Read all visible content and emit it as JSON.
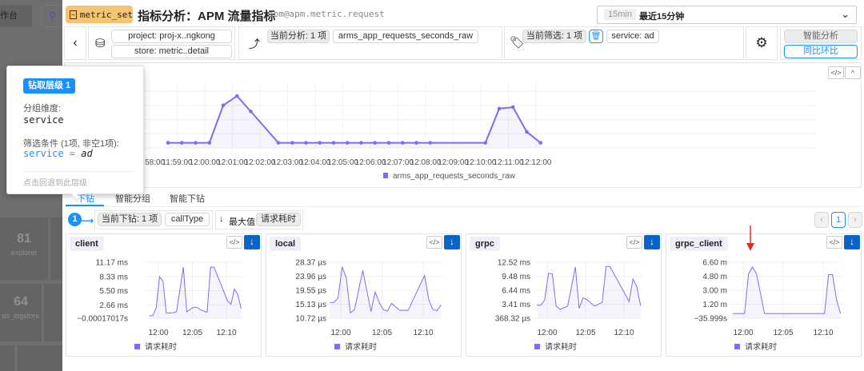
{
  "background": {
    "tab_label": "作台",
    "tiles": [
      {
        "count": "81",
        "name": "explorer"
      },
      {
        "count": "64",
        "name": "ds_logstore"
      }
    ]
  },
  "header": {
    "badge": "metric_set",
    "title": "指标分析：APM 流量指标",
    "subtitle": "apm@apm.metric.request",
    "time_picker": {
      "short": "15min",
      "label": "最近15分钟"
    }
  },
  "toolbar": {
    "project": "project: proj-x..ngkong",
    "store": "store: metric..detail",
    "analysis_count": "当前分析: 1 项",
    "analysis_metric": "arms_app_requests_seconds_raw",
    "filter_count": "当前筛选: 1 项",
    "filter_value": "service: ad",
    "smart_analysis": "智能分析",
    "yoy": "同比环比"
  },
  "popup": {
    "level_badge": "钻取层级  1",
    "group_label": "分组维度:",
    "group_value": "service",
    "filter_label": "筛选条件 (1项, 非空1项):",
    "filter_key": "service",
    "filter_op": " = ",
    "filter_val": "ad",
    "footer": "点击回退到此层级"
  },
  "tabs": [
    {
      "label": "下钻",
      "active": true
    },
    {
      "label": "智能分组",
      "active": false
    },
    {
      "label": "智能下钻",
      "active": false
    }
  ],
  "drill": {
    "step": "1",
    "count": "当前下钻: 1 项",
    "dimension": "callType",
    "sort_icon": "↓",
    "sort_label": "最大值",
    "sort_metric": "请求耗时"
  },
  "pagination": {
    "current": "1"
  },
  "colors": {
    "series": "#7b6ff0",
    "accent": "#1890ff",
    "badge": "#f6c36e",
    "download": "#0a64c8",
    "arrow": "#e0302a"
  },
  "chart_data": [
    {
      "type": "line",
      "legend": "arms_app_requests_seconds_raw",
      "grid": true,
      "legend_position": "bottom",
      "xticks": [
        "11:58:00",
        "11:59:00",
        "12:00:00",
        "12:01:00",
        "12:02:00",
        "12:03:00",
        "12:04:00",
        "12:05:00",
        "12:06:00",
        "12:07:00",
        "12:08:00",
        "12:09:00",
        "12:10:00",
        "12:11:00",
        "12:12:00"
      ],
      "ylim": [
        0,
        4
      ],
      "points": [
        [
          "11:58:40",
          0.36
        ],
        [
          "11:59:10",
          0.36
        ],
        [
          "11:59:40",
          0.36
        ],
        [
          "12:00:10",
          0.36
        ],
        [
          "12:00:40",
          3.0
        ],
        [
          "12:01:10",
          3.66
        ],
        [
          "12:01:40",
          2.57
        ],
        [
          "12:02:40",
          0.36
        ],
        [
          "12:03:10",
          0.36
        ],
        [
          "12:03:40",
          0.36
        ],
        [
          "12:04:10",
          0.36
        ],
        [
          "12:04:40",
          0.36
        ],
        [
          "12:05:10",
          0.36
        ],
        [
          "12:05:40",
          0.36
        ],
        [
          "12:06:10",
          0.36
        ],
        [
          "12:06:40",
          0.36
        ],
        [
          "12:07:10",
          0.36
        ],
        [
          "12:07:40",
          0.36
        ],
        [
          "12:08:10",
          0.36
        ],
        [
          "12:10:10",
          0.36
        ],
        [
          "12:10:40",
          2.77
        ],
        [
          "12:11:10",
          2.87
        ],
        [
          "12:11:40",
          1.13
        ],
        [
          "12:12:10",
          0.36
        ]
      ]
    },
    {
      "type": "line",
      "title": "client",
      "legend": "请求耗时",
      "xticks": [
        "12:00",
        "12:05",
        "12:10"
      ],
      "yticks": [
        {
          "v": 0,
          "label": "−0.00017017s"
        },
        {
          "v": 2.66,
          "label": "2.66 ms"
        },
        {
          "v": 5.5,
          "label": "5.50 ms"
        },
        {
          "v": 8.33,
          "label": "8.33 ms"
        },
        {
          "v": 11.17,
          "label": "11.17 ms"
        }
      ],
      "points": [
        [
          "11:58:40",
          0.5
        ],
        [
          "11:59:10",
          0.5
        ],
        [
          "11:59:40",
          2.0
        ],
        [
          "12:00:10",
          8.3
        ],
        [
          "12:00:40",
          7.4
        ],
        [
          "12:01:10",
          1.0
        ],
        [
          "12:02:10",
          1.1
        ],
        [
          "12:02:40",
          1.3
        ],
        [
          "12:03:40",
          10.2
        ],
        [
          "12:04:10",
          1.3
        ],
        [
          "12:05:10",
          2.2
        ],
        [
          "12:05:40",
          2.2
        ],
        [
          "12:06:10",
          1.7
        ],
        [
          "12:07:10",
          1.2
        ],
        [
          "12:07:40",
          10.2
        ],
        [
          "12:08:10",
          10.2
        ],
        [
          "12:10:10",
          3.5
        ],
        [
          "12:10:40",
          2.8
        ],
        [
          "12:11:10",
          5.8
        ],
        [
          "12:11:40",
          4.8
        ],
        [
          "12:12:10",
          1.9
        ]
      ]
    },
    {
      "type": "line",
      "title": "local",
      "legend": "请求耗时",
      "xticks": [
        "12:00",
        "12:05",
        "12:10"
      ],
      "yticks": [
        {
          "v": 10.72,
          "label": "10.72 µs"
        },
        {
          "v": 15.13,
          "label": "15.13 µs"
        },
        {
          "v": 19.55,
          "label": "19.55 µs"
        },
        {
          "v": 23.96,
          "label": "23.96 µs"
        },
        {
          "v": 28.37,
          "label": "28.37 µs"
        }
      ],
      "points": [
        [
          "11:58:40",
          15.7
        ],
        [
          "11:59:10",
          15.7
        ],
        [
          "11:59:40",
          17.1
        ],
        [
          "12:00:10",
          26.9
        ],
        [
          "12:00:40",
          23.4
        ],
        [
          "12:01:10",
          12.4
        ],
        [
          "12:01:40",
          13.5
        ],
        [
          "12:02:40",
          25.8
        ],
        [
          "12:03:40",
          12.8
        ],
        [
          "12:04:10",
          19.0
        ],
        [
          "12:04:40",
          15.7
        ],
        [
          "12:05:10",
          13.4
        ],
        [
          "12:05:40",
          13.0
        ],
        [
          "12:06:10",
          15.4
        ],
        [
          "12:07:10",
          13.2
        ],
        [
          "12:08:10",
          13.2
        ],
        [
          "12:10:10",
          24.2
        ],
        [
          "12:10:40",
          16.7
        ],
        [
          "12:11:10",
          13.5
        ],
        [
          "12:11:40",
          13.1
        ],
        [
          "12:12:10",
          14.9
        ]
      ]
    },
    {
      "type": "line",
      "title": "grpc",
      "legend": "请求耗时",
      "xticks": [
        "12:00",
        "12:05",
        "12:10"
      ],
      "yticks": [
        {
          "v": 0.368,
          "label": "368.32 µs"
        },
        {
          "v": 3.41,
          "label": "3.41 ms"
        },
        {
          "v": 6.44,
          "label": "6.44 ms"
        },
        {
          "v": 9.48,
          "label": "9.48 ms"
        },
        {
          "v": 12.52,
          "label": "12.52 ms"
        }
      ],
      "points": [
        [
          "11:58:40",
          3.2
        ],
        [
          "11:59:10",
          3.2
        ],
        [
          "11:59:40",
          4.3
        ],
        [
          "12:00:10",
          10.1
        ],
        [
          "12:00:40",
          10.0
        ],
        [
          "12:01:10",
          3.0
        ],
        [
          "12:01:40",
          2.3
        ],
        [
          "12:02:40",
          3.0
        ],
        [
          "12:03:40",
          11.5
        ],
        [
          "12:04:10",
          2.5
        ],
        [
          "12:04:40",
          4.8
        ],
        [
          "12:05:10",
          4.4
        ],
        [
          "12:06:10",
          3.0
        ],
        [
          "12:07:10",
          3.8
        ],
        [
          "12:07:40",
          11.6
        ],
        [
          "12:08:10",
          11.6
        ],
        [
          "12:10:40",
          4.0
        ],
        [
          "12:11:10",
          8.9
        ],
        [
          "12:11:40",
          7.2
        ],
        [
          "12:12:10",
          3.1
        ]
      ]
    },
    {
      "type": "line",
      "title": "grpc_client",
      "legend": "请求耗时",
      "xticks": [
        "12:00",
        "12:05",
        "12:10"
      ],
      "yticks": [
        {
          "v": -0.6,
          "label": "−35.999s"
        },
        {
          "v": 1.2,
          "label": "1.20 m"
        },
        {
          "v": 3.0,
          "label": "3.00 m"
        },
        {
          "v": 4.8,
          "label": "4.80 m"
        },
        {
          "v": 6.6,
          "label": "6.60 m"
        }
      ],
      "points": [
        [
          "11:58:40",
          0
        ],
        [
          "12:00:10",
          0
        ],
        [
          "12:00:40",
          5.1
        ],
        [
          "12:01:10",
          6.0
        ],
        [
          "12:01:40",
          5.1
        ],
        [
          "12:02:40",
          0
        ],
        [
          "12:10:10",
          0
        ],
        [
          "12:10:40",
          5.0
        ],
        [
          "12:11:10",
          5.0
        ],
        [
          "12:11:40",
          1.8
        ],
        [
          "12:12:10",
          0
        ]
      ]
    }
  ]
}
